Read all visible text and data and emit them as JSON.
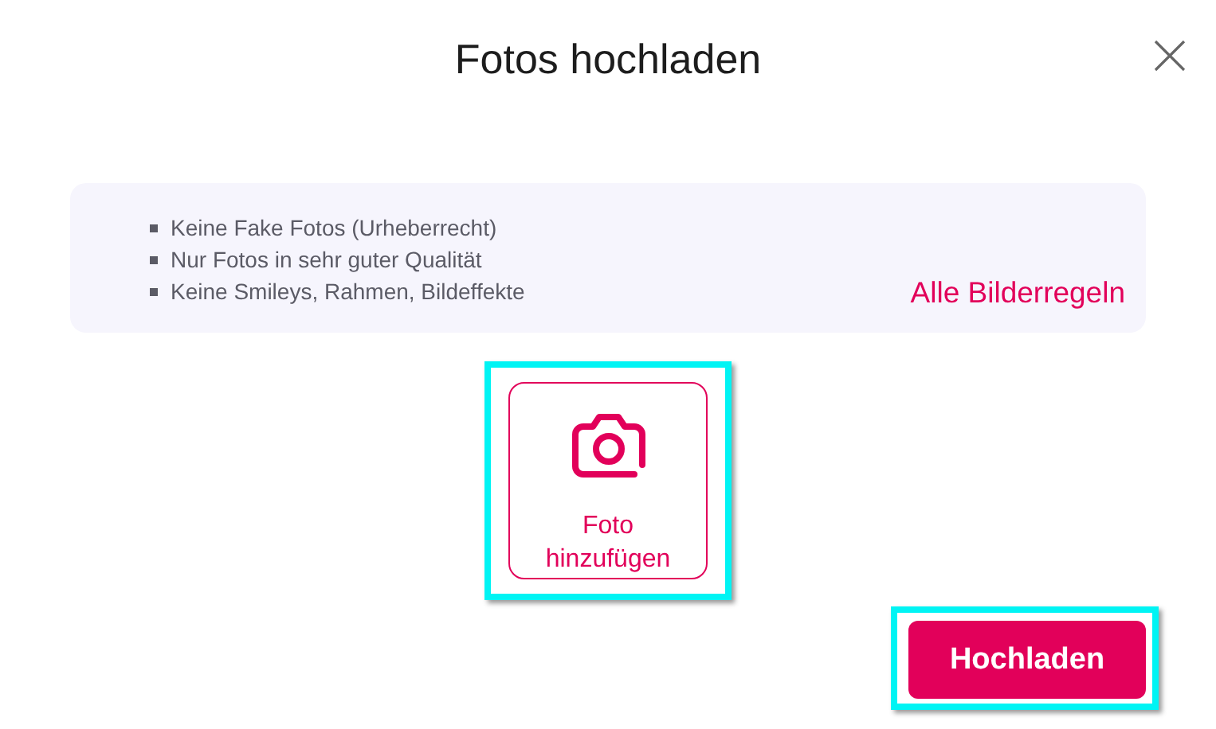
{
  "dialog": {
    "title": "Fotos hochladen"
  },
  "rules": {
    "items": [
      "Keine Fake Fotos (Urheberrecht)",
      "Nur Fotos in sehr guter Qualität",
      "Keine Smileys, Rahmen, Bildeffekte"
    ],
    "link": "Alle Bilderregeln"
  },
  "add_photo": {
    "label": "Foto hinzufügen",
    "highlighted": true
  },
  "upload_button": {
    "label": "Hochladen",
    "highlighted": true
  }
}
